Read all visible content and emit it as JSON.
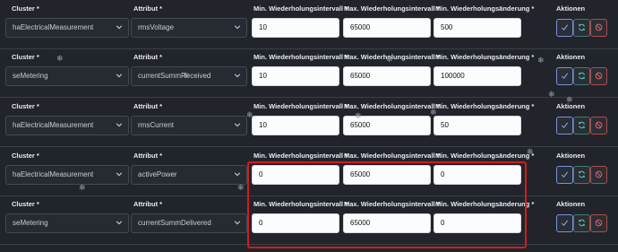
{
  "labels": {
    "cluster": "Cluster *",
    "attribute": "Attribut *",
    "min_interval": "Min. Wiederholungsintervall *",
    "max_interval": "Max. Wiederholungsintervall *",
    "min_change": "Min. Wiederholungsänderung *",
    "actions": "Aktionen"
  },
  "rows": [
    {
      "cluster": "haElectricalMeasurement",
      "attribute": "rmsVoltage",
      "min": "10",
      "max": "65000",
      "change": "500"
    },
    {
      "cluster": "seMetering",
      "attribute": "currentSummReceived",
      "min": "10",
      "max": "65000",
      "change": "100000"
    },
    {
      "cluster": "haElectricalMeasurement",
      "attribute": "rmsCurrent",
      "min": "10",
      "max": "65000",
      "change": "50"
    },
    {
      "cluster": "haElectricalMeasurement",
      "attribute": "activePower",
      "min": "0",
      "max": "65000",
      "change": "0"
    },
    {
      "cluster": "seMetering",
      "attribute": "currentSummDelivered",
      "min": "0",
      "max": "65000",
      "change": "0"
    }
  ],
  "icons": {
    "dropdown": "chevron-down-icon",
    "confirm": "check-icon",
    "refresh": "refresh-icon",
    "remove": "ban-icon",
    "decoration": "snowflake-icon"
  },
  "colors": {
    "highlight": "#d41b1b",
    "confirm": "#7b8fe0",
    "refresh": "#3e7d73",
    "remove": "#b54a4a"
  }
}
